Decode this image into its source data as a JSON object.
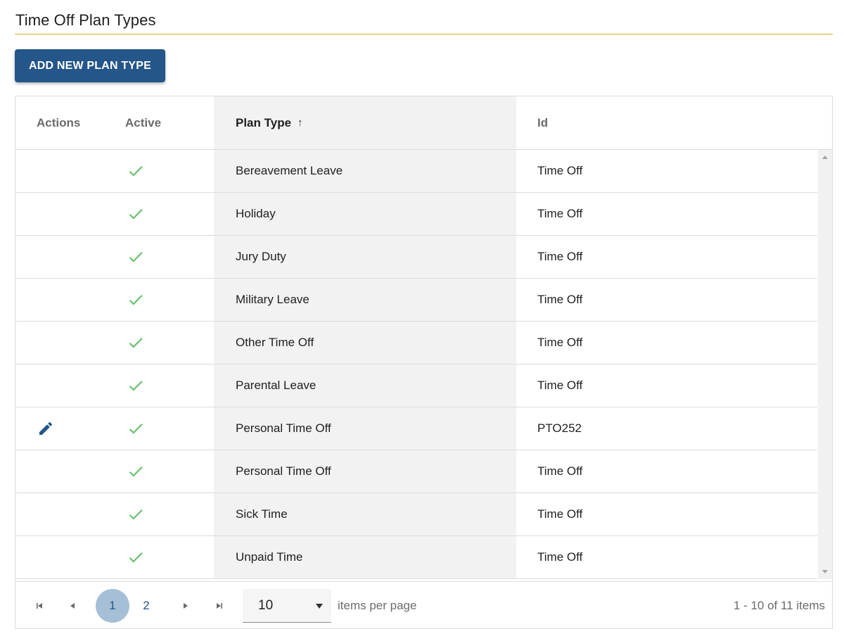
{
  "page": {
    "title": "Time Off Plan Types"
  },
  "toolbar": {
    "add_label": "ADD NEW PLAN TYPE"
  },
  "colors": {
    "primary": "#245689",
    "rule": "#d6a82a",
    "check": "#6cc170",
    "current_page_bg": "#a5bfd6"
  },
  "grid": {
    "columns": {
      "actions": "Actions",
      "active": "Active",
      "plan_type": "Plan Type",
      "plan_type_sort_icon": "↑",
      "id": "Id"
    },
    "column_menu_icon": "kebab-menu-icon",
    "rows": [
      {
        "editable": false,
        "active": true,
        "plan_type": "Bereavement Leave",
        "id": "Time Off"
      },
      {
        "editable": false,
        "active": true,
        "plan_type": "Holiday",
        "id": "Time Off"
      },
      {
        "editable": false,
        "active": true,
        "plan_type": "Jury Duty",
        "id": "Time Off"
      },
      {
        "editable": false,
        "active": true,
        "plan_type": "Military Leave",
        "id": "Time Off"
      },
      {
        "editable": false,
        "active": true,
        "plan_type": "Other Time Off",
        "id": "Time Off"
      },
      {
        "editable": false,
        "active": true,
        "plan_type": "Parental Leave",
        "id": "Time Off"
      },
      {
        "editable": true,
        "active": true,
        "plan_type": "Personal Time Off",
        "id": "PTO252"
      },
      {
        "editable": false,
        "active": true,
        "plan_type": "Personal Time Off",
        "id": "Time Off"
      },
      {
        "editable": false,
        "active": true,
        "plan_type": "Sick Time",
        "id": "Time Off"
      },
      {
        "editable": false,
        "active": true,
        "plan_type": "Unpaid Time",
        "id": "Time Off"
      }
    ]
  },
  "pager": {
    "pages": [
      "1",
      "2"
    ],
    "current_page": "1",
    "page_size": "10",
    "page_size_label": "items per page",
    "info": "1 - 10 of 11 items",
    "icons": {
      "first": "first-page-icon",
      "prev": "prev-page-icon",
      "next": "next-page-icon",
      "last": "last-page-icon"
    }
  }
}
